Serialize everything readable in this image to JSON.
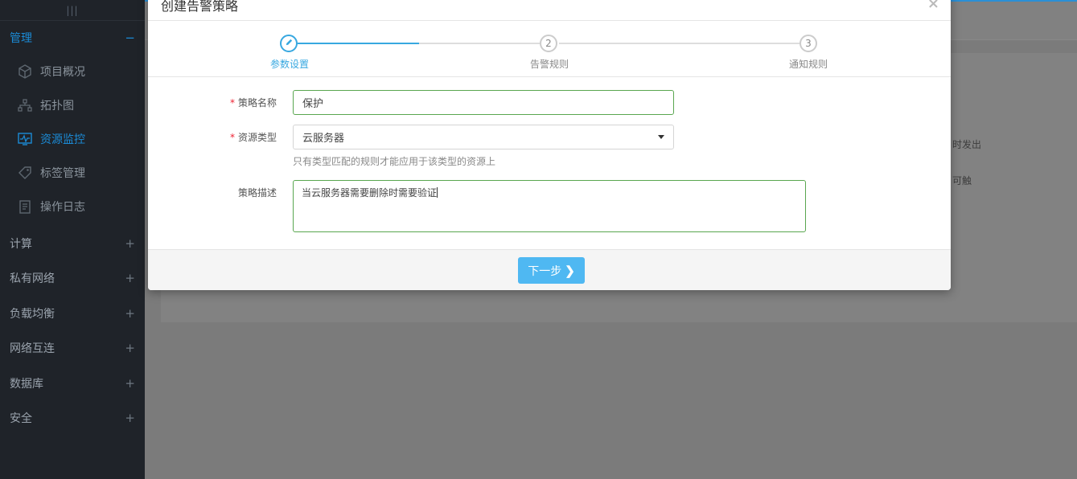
{
  "sidebar": {
    "handle": "|||",
    "group_active": {
      "label": "管理",
      "toggle": "−"
    },
    "items": [
      {
        "label": "项目概况",
        "icon": "cube-icon"
      },
      {
        "label": "拓扑图",
        "icon": "topology-icon"
      },
      {
        "label": "资源监控",
        "icon": "monitor-icon"
      },
      {
        "label": "标签管理",
        "icon": "tag-icon"
      },
      {
        "label": "操作日志",
        "icon": "log-icon"
      }
    ],
    "groups": [
      {
        "label": "计算",
        "toggle": "+"
      },
      {
        "label": "私有网络",
        "toggle": "+"
      },
      {
        "label": "负载均衡",
        "toggle": "+"
      },
      {
        "label": "网络互连",
        "toggle": "+"
      },
      {
        "label": "数据库",
        "toggle": "+"
      },
      {
        "label": "安全",
        "toggle": "+"
      }
    ]
  },
  "background": {
    "text_1": "时发出",
    "text_2": "可触"
  },
  "modal": {
    "title": "创建告警策略",
    "close": "×",
    "steps": [
      {
        "number": "",
        "label": "参数设置"
      },
      {
        "number": "2",
        "label": "告警规则"
      },
      {
        "number": "3",
        "label": "通知规则"
      }
    ],
    "form": {
      "name_label": "策略名称",
      "name_value": "保护",
      "type_label": "资源类型",
      "type_value": "云服务器",
      "type_help": "只有类型匹配的规则才能应用于该类型的资源上",
      "desc_label": "策略描述",
      "desc_value": "当云服务器需要删除时需要验证",
      "required_mark": "*"
    },
    "next_button": "下一步"
  },
  "colors": {
    "accent": "#38a8e0",
    "sidebar_bg": "#1f2329",
    "input_border_valid": "#59a64f",
    "button_bg": "#4fb8f2"
  }
}
